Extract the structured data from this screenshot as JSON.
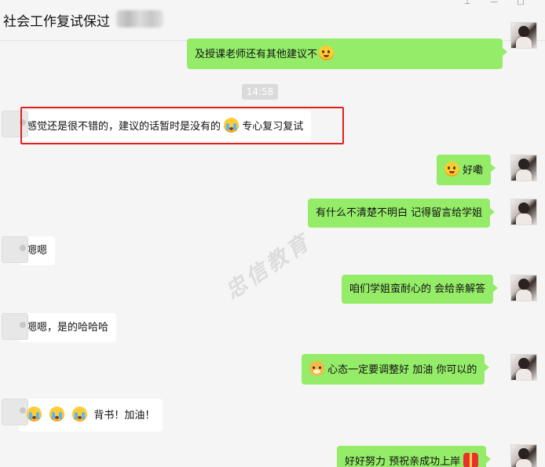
{
  "window": {
    "title": "社会工作复试保过",
    "controls": [
      "pin",
      "minimize",
      "close"
    ]
  },
  "watermark": "忠信教育",
  "messages": [
    {
      "dir": "out",
      "text": "及授课老师还有其他建议不",
      "emoji_after": [
        "smirk-face"
      ]
    },
    {
      "type": "timestamp",
      "text": "14:58"
    },
    {
      "dir": "in",
      "text_before": "感觉还是很不错的，建议的话暂时是没有的",
      "emoji_mid": [
        "crying-face"
      ],
      "text_after": "专心复习复试",
      "highlighted": true
    },
    {
      "dir": "out",
      "emoji_before": [
        "shush-face"
      ],
      "text": "好嘞"
    },
    {
      "dir": "out",
      "text": "有什么不清楚不明白 记得留言给学姐"
    },
    {
      "dir": "in",
      "text": "嗯嗯"
    },
    {
      "dir": "out",
      "text": "咱们学姐蛮耐心的 会给亲解答"
    },
    {
      "dir": "in",
      "text": "嗯嗯，是的哈哈哈"
    },
    {
      "dir": "out",
      "emoji_before": [
        "doge-icon"
      ],
      "text": "心态一定要调整好  加油 你可以的"
    },
    {
      "dir": "in",
      "emoji_before": [
        "crying-face",
        "crying-face",
        "crying-face"
      ],
      "text": "背书！加油！"
    },
    {
      "dir": "out",
      "text": "好好努力 预祝亲成功上岸",
      "emoji_after": [
        "gift-icon"
      ]
    }
  ]
}
